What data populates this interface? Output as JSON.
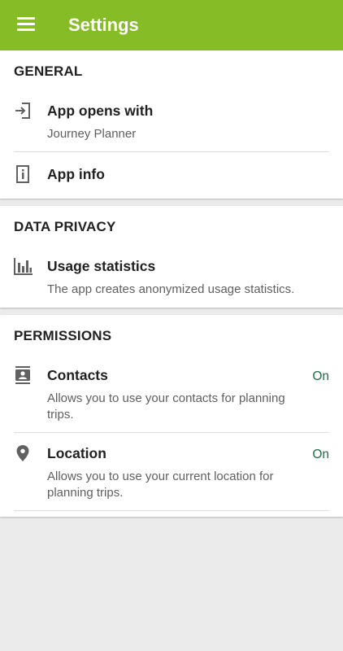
{
  "appbar": {
    "title": "Settings",
    "menu_icon": "hamburger-menu-icon"
  },
  "colors": {
    "accent": "#86bc25",
    "on_status": "#1f6e46",
    "background": "#ebebeb"
  },
  "sections": {
    "general": {
      "title": "GENERAL",
      "app_opens_with": {
        "icon": "login-arrow-icon",
        "title": "App opens with",
        "value": "Journey Planner"
      },
      "app_info": {
        "icon": "info-icon",
        "title": "App info"
      }
    },
    "data_privacy": {
      "title": "DATA PRIVACY",
      "usage_statistics": {
        "icon": "bar-chart-icon",
        "title": "Usage statistics",
        "description": "The app creates anonymized usage statistics."
      }
    },
    "permissions": {
      "title": "PERMISSIONS",
      "contacts": {
        "icon": "contact-card-icon",
        "title": "Contacts",
        "status": "On",
        "description_line1": "Allows you to use your contacts for planning",
        "description_line2": "trips."
      },
      "location": {
        "icon": "location-pin-icon",
        "title": "Location",
        "status": "On",
        "description_line1": "Allows you to use your current location for",
        "description_line2": "planning trips."
      }
    }
  }
}
